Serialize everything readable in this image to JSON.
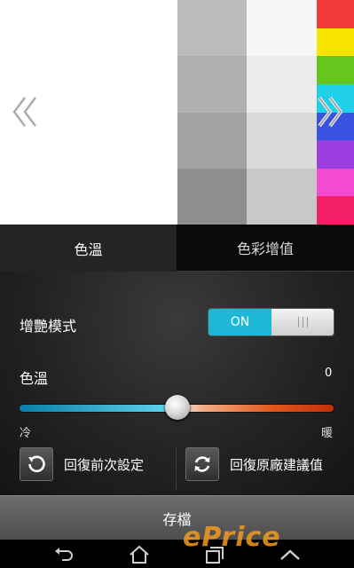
{
  "preview": {
    "left_arrow_icon": "double-chevron-left-icon",
    "right_arrow_icon": "double-chevron-right-icon",
    "gray_swatches_col1": [
      "#bcbcbc",
      "#b0b0b0",
      "#a2a2a2",
      "#8e8e8e"
    ],
    "gray_swatches_col2": [
      "#f6f6f6",
      "#ececec",
      "#dadada",
      "#c8c8c8"
    ],
    "color_swatches": [
      "#f23a3a",
      "#f8e600",
      "#66c51f",
      "#1fd0e8",
      "#3a52e0",
      "#9b3fe0",
      "#f24bd2",
      "#f21f68"
    ]
  },
  "tabs": [
    {
      "label": "色溫"
    },
    {
      "label": "色彩增值"
    }
  ],
  "vivid_mode": {
    "label": "增艷模式",
    "toggle_on_label": "ON",
    "is_on": true
  },
  "color_temp": {
    "label": "色溫",
    "value": "0",
    "min_label": "冷",
    "max_label": "暖",
    "slider_fraction": 0.5
  },
  "buttons": {
    "restore_previous": "回復前次設定",
    "restore_default": "回復原廠建議值",
    "restore_previous_icon": "undo-icon",
    "restore_default_icon": "refresh-icon"
  },
  "save_label": "存檔",
  "navbar": {
    "back_icon": "back-icon",
    "home_icon": "home-icon",
    "recent_icon": "recent-apps-icon",
    "up_icon": "chevron-up-icon"
  },
  "watermark": "ePrice",
  "colors": {
    "accent": "#1cb8d6",
    "panel_bg": "#232323"
  }
}
